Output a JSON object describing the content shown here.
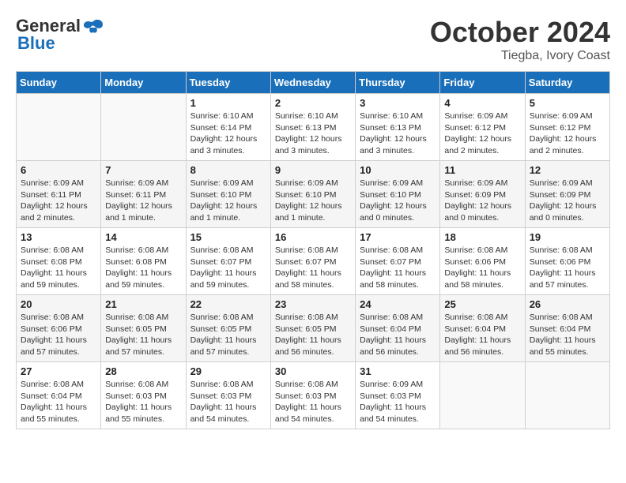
{
  "header": {
    "logo_general": "General",
    "logo_blue": "Blue",
    "month": "October 2024",
    "location": "Tiegba, Ivory Coast"
  },
  "days_of_week": [
    "Sunday",
    "Monday",
    "Tuesday",
    "Wednesday",
    "Thursday",
    "Friday",
    "Saturday"
  ],
  "weeks": [
    [
      {
        "day": "",
        "info": ""
      },
      {
        "day": "",
        "info": ""
      },
      {
        "day": "1",
        "info": "Sunrise: 6:10 AM\nSunset: 6:14 PM\nDaylight: 12 hours\nand 3 minutes."
      },
      {
        "day": "2",
        "info": "Sunrise: 6:10 AM\nSunset: 6:13 PM\nDaylight: 12 hours\nand 3 minutes."
      },
      {
        "day": "3",
        "info": "Sunrise: 6:10 AM\nSunset: 6:13 PM\nDaylight: 12 hours\nand 3 minutes."
      },
      {
        "day": "4",
        "info": "Sunrise: 6:09 AM\nSunset: 6:12 PM\nDaylight: 12 hours\nand 2 minutes."
      },
      {
        "day": "5",
        "info": "Sunrise: 6:09 AM\nSunset: 6:12 PM\nDaylight: 12 hours\nand 2 minutes."
      }
    ],
    [
      {
        "day": "6",
        "info": "Sunrise: 6:09 AM\nSunset: 6:11 PM\nDaylight: 12 hours\nand 2 minutes."
      },
      {
        "day": "7",
        "info": "Sunrise: 6:09 AM\nSunset: 6:11 PM\nDaylight: 12 hours\nand 1 minute."
      },
      {
        "day": "8",
        "info": "Sunrise: 6:09 AM\nSunset: 6:10 PM\nDaylight: 12 hours\nand 1 minute."
      },
      {
        "day": "9",
        "info": "Sunrise: 6:09 AM\nSunset: 6:10 PM\nDaylight: 12 hours\nand 1 minute."
      },
      {
        "day": "10",
        "info": "Sunrise: 6:09 AM\nSunset: 6:10 PM\nDaylight: 12 hours\nand 0 minutes."
      },
      {
        "day": "11",
        "info": "Sunrise: 6:09 AM\nSunset: 6:09 PM\nDaylight: 12 hours\nand 0 minutes."
      },
      {
        "day": "12",
        "info": "Sunrise: 6:09 AM\nSunset: 6:09 PM\nDaylight: 12 hours\nand 0 minutes."
      }
    ],
    [
      {
        "day": "13",
        "info": "Sunrise: 6:08 AM\nSunset: 6:08 PM\nDaylight: 11 hours\nand 59 minutes."
      },
      {
        "day": "14",
        "info": "Sunrise: 6:08 AM\nSunset: 6:08 PM\nDaylight: 11 hours\nand 59 minutes."
      },
      {
        "day": "15",
        "info": "Sunrise: 6:08 AM\nSunset: 6:07 PM\nDaylight: 11 hours\nand 59 minutes."
      },
      {
        "day": "16",
        "info": "Sunrise: 6:08 AM\nSunset: 6:07 PM\nDaylight: 11 hours\nand 58 minutes."
      },
      {
        "day": "17",
        "info": "Sunrise: 6:08 AM\nSunset: 6:07 PM\nDaylight: 11 hours\nand 58 minutes."
      },
      {
        "day": "18",
        "info": "Sunrise: 6:08 AM\nSunset: 6:06 PM\nDaylight: 11 hours\nand 58 minutes."
      },
      {
        "day": "19",
        "info": "Sunrise: 6:08 AM\nSunset: 6:06 PM\nDaylight: 11 hours\nand 57 minutes."
      }
    ],
    [
      {
        "day": "20",
        "info": "Sunrise: 6:08 AM\nSunset: 6:06 PM\nDaylight: 11 hours\nand 57 minutes."
      },
      {
        "day": "21",
        "info": "Sunrise: 6:08 AM\nSunset: 6:05 PM\nDaylight: 11 hours\nand 57 minutes."
      },
      {
        "day": "22",
        "info": "Sunrise: 6:08 AM\nSunset: 6:05 PM\nDaylight: 11 hours\nand 57 minutes."
      },
      {
        "day": "23",
        "info": "Sunrise: 6:08 AM\nSunset: 6:05 PM\nDaylight: 11 hours\nand 56 minutes."
      },
      {
        "day": "24",
        "info": "Sunrise: 6:08 AM\nSunset: 6:04 PM\nDaylight: 11 hours\nand 56 minutes."
      },
      {
        "day": "25",
        "info": "Sunrise: 6:08 AM\nSunset: 6:04 PM\nDaylight: 11 hours\nand 56 minutes."
      },
      {
        "day": "26",
        "info": "Sunrise: 6:08 AM\nSunset: 6:04 PM\nDaylight: 11 hours\nand 55 minutes."
      }
    ],
    [
      {
        "day": "27",
        "info": "Sunrise: 6:08 AM\nSunset: 6:04 PM\nDaylight: 11 hours\nand 55 minutes."
      },
      {
        "day": "28",
        "info": "Sunrise: 6:08 AM\nSunset: 6:03 PM\nDaylight: 11 hours\nand 55 minutes."
      },
      {
        "day": "29",
        "info": "Sunrise: 6:08 AM\nSunset: 6:03 PM\nDaylight: 11 hours\nand 54 minutes."
      },
      {
        "day": "30",
        "info": "Sunrise: 6:08 AM\nSunset: 6:03 PM\nDaylight: 11 hours\nand 54 minutes."
      },
      {
        "day": "31",
        "info": "Sunrise: 6:09 AM\nSunset: 6:03 PM\nDaylight: 11 hours\nand 54 minutes."
      },
      {
        "day": "",
        "info": ""
      },
      {
        "day": "",
        "info": ""
      }
    ]
  ]
}
